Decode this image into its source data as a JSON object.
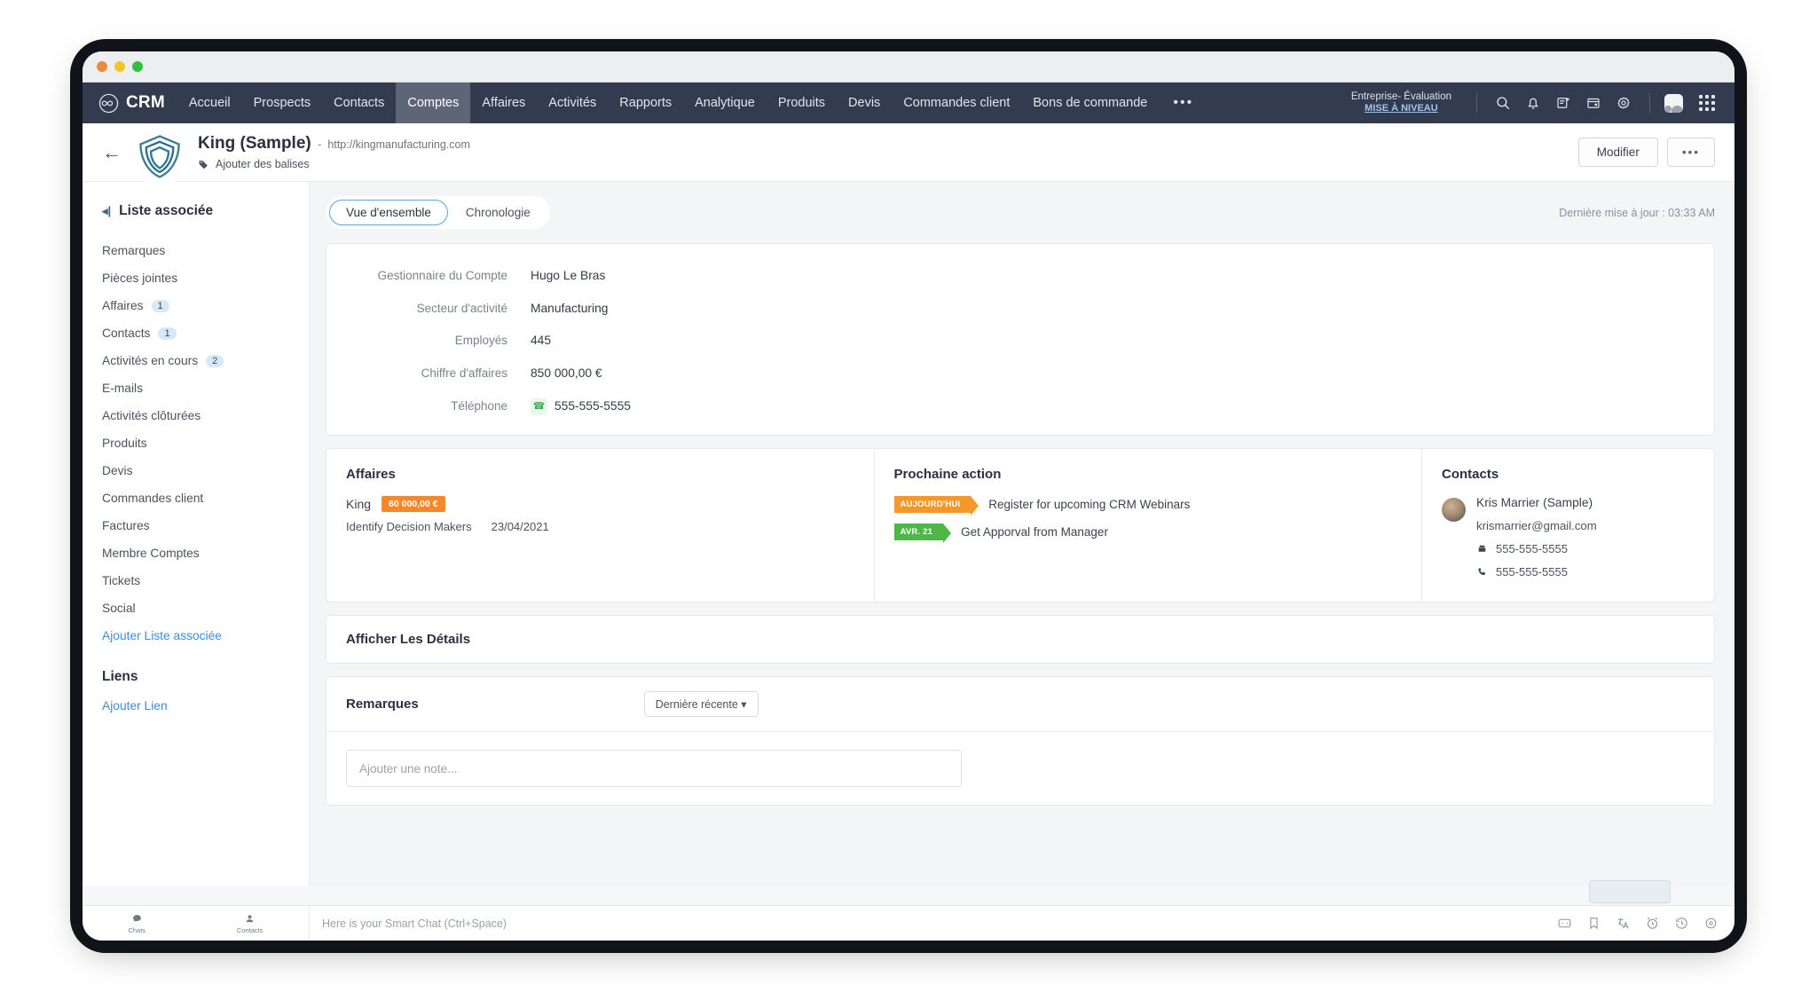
{
  "window": {
    "dots": [
      "close",
      "minimize",
      "maximize"
    ]
  },
  "topnav": {
    "brand": "CRM",
    "items": [
      {
        "label": "Accueil",
        "active": false
      },
      {
        "label": "Prospects",
        "active": false
      },
      {
        "label": "Contacts",
        "active": false
      },
      {
        "label": "Comptes",
        "active": true
      },
      {
        "label": "Affaires",
        "active": false
      },
      {
        "label": "Activités",
        "active": false
      },
      {
        "label": "Rapports",
        "active": false
      },
      {
        "label": "Analytique",
        "active": false
      },
      {
        "label": "Produits",
        "active": false
      },
      {
        "label": "Devis",
        "active": false
      },
      {
        "label": "Commandes client",
        "active": false
      },
      {
        "label": "Bons de commande",
        "active": false
      }
    ],
    "more_label": "•••",
    "enterprise": {
      "line1": "Entreprise- Évaluation",
      "line2": "MISE À NIVEAU"
    },
    "icons": [
      "search-icon",
      "bell-icon",
      "add-note-icon",
      "calendar-icon",
      "gear-icon",
      "avatar",
      "apps-grid-icon"
    ]
  },
  "record": {
    "title": "King (Sample)",
    "dash": "-",
    "url": "http://kingmanufacturing.com",
    "tags_label": "Ajouter des balises",
    "edit_button": "Modifier",
    "more_button": "•••"
  },
  "sidebar": {
    "title": "Liste associée",
    "items": [
      {
        "label": "Remarques",
        "badge": null,
        "link": false
      },
      {
        "label": "Pièces jointes",
        "badge": null,
        "link": false
      },
      {
        "label": "Affaires",
        "badge": "1",
        "link": false
      },
      {
        "label": "Contacts",
        "badge": "1",
        "link": false
      },
      {
        "label": "Activités en cours",
        "badge": "2",
        "link": false
      },
      {
        "label": "E-mails",
        "badge": null,
        "link": false
      },
      {
        "label": "Activités clôturées",
        "badge": null,
        "link": false
      },
      {
        "label": "Produits",
        "badge": null,
        "link": false
      },
      {
        "label": "Devis",
        "badge": null,
        "link": false
      },
      {
        "label": "Commandes client",
        "badge": null,
        "link": false
      },
      {
        "label": "Factures",
        "badge": null,
        "link": false
      },
      {
        "label": "Membre Comptes",
        "badge": null,
        "link": false
      },
      {
        "label": "Tickets",
        "badge": null,
        "link": false
      },
      {
        "label": "Social",
        "badge": null,
        "link": false
      },
      {
        "label": "Ajouter Liste associée",
        "badge": null,
        "link": true
      }
    ],
    "links_section": "Liens",
    "add_link": "Ajouter Lien"
  },
  "main": {
    "tabs": [
      {
        "label": "Vue d'ensemble",
        "active": true
      },
      {
        "label": "Chronologie",
        "active": false
      }
    ],
    "last_update": "Dernière mise à jour : 03:33 AM",
    "fields": [
      {
        "label": "Gestionnaire du Compte",
        "value": "Hugo Le Bras",
        "icon": null
      },
      {
        "label": "Secteur d'activité",
        "value": "Manufacturing",
        "icon": null
      },
      {
        "label": "Employés",
        "value": "445",
        "icon": null
      },
      {
        "label": "Chiffre d'affaires",
        "value": "850 000,00 €",
        "icon": null
      },
      {
        "label": "Téléphone",
        "value": "555-555-5555",
        "icon": "phone-icon"
      }
    ],
    "deals": {
      "title": "Affaires",
      "name": "King",
      "amount": "60 000,00 €",
      "stage": "Identify Decision Makers",
      "date": "23/04/2021"
    },
    "next_action": {
      "title": "Prochaine action",
      "items": [
        {
          "flag": "AUJOURD'HUI",
          "flag_type": "today",
          "text": "Register for upcoming CRM Webinars"
        },
        {
          "flag": "AVR. 21",
          "flag_type": "apr",
          "text": "Get Apporval from Manager"
        }
      ]
    },
    "contacts": {
      "title": "Contacts",
      "name": "Kris Marrier (Sample)",
      "email": "krismarrier@gmail.com",
      "phone1": "555-555-5555",
      "phone2": "555-555-5555"
    },
    "details_section": "Afficher Les Détails",
    "remarks": {
      "title": "Remarques",
      "sort_label": "Dernière récente ▾",
      "note_placeholder": "Ajouter une note..."
    }
  },
  "chatbar": {
    "chats_label": "Chats",
    "contacts_label": "Contacts",
    "input_placeholder": "Here is your Smart Chat (Ctrl+Space)"
  },
  "colors": {
    "nav_bg": "#333b4f",
    "accent_orange": "#f5882b",
    "accent_green": "#4db747",
    "link_blue": "#3b8fd4"
  }
}
